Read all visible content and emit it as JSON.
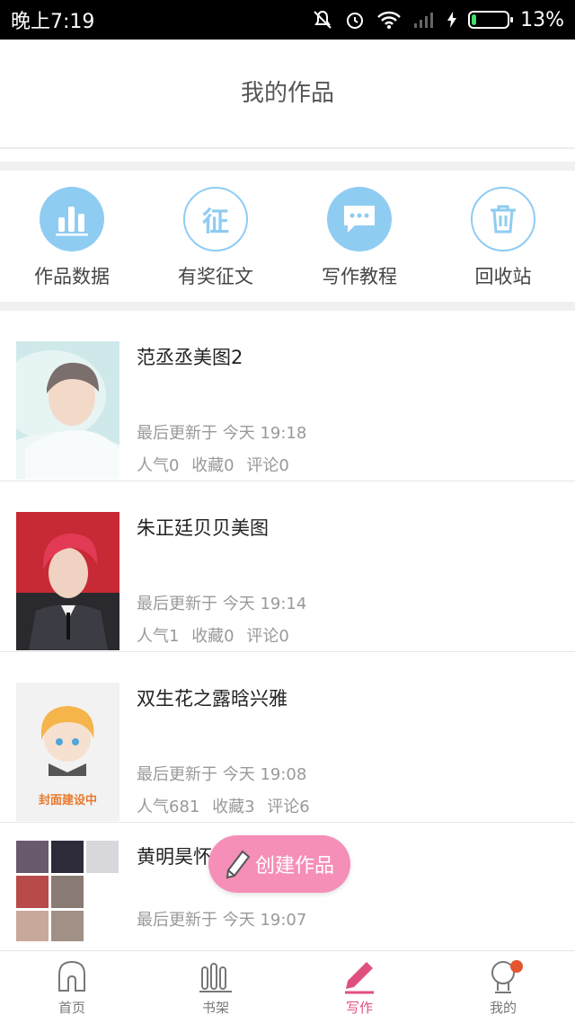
{
  "status_bar": {
    "time": "晚上7:19",
    "battery": "13%",
    "battery_level": 0.13
  },
  "header": {
    "title": "我的作品"
  },
  "quick_actions": [
    {
      "label": "作品数据",
      "icon": "bar-chart-icon"
    },
    {
      "label": "有奖征文",
      "icon": "contest-icon",
      "glyph": "征"
    },
    {
      "label": "写作教程",
      "icon": "chat-bubble-icon"
    },
    {
      "label": "回收站",
      "icon": "trash-icon"
    }
  ],
  "works": [
    {
      "title": "范丞丞美图2",
      "updated": "最后更新于 今天 19:18",
      "popularity": "人气0",
      "favorites": "收藏0",
      "comments": "评论0"
    },
    {
      "title": "朱正廷贝贝美图",
      "updated": "最后更新于 今天 19:14",
      "popularity": "人气1",
      "favorites": "收藏0",
      "comments": "评论0"
    },
    {
      "title": "双生花之露晗兴雅",
      "updated": "最后更新于 今天 19:08",
      "popularity": "人气681",
      "favorites": "收藏3",
      "comments": "评论6",
      "cover_text": "封面建设中"
    },
    {
      "title": "黄明昊怀",
      "updated": "最后更新于 今天 19:07"
    }
  ],
  "fab": {
    "label": "创建作品"
  },
  "tabbar": [
    {
      "label": "首页",
      "icon": "home-icon"
    },
    {
      "label": "书架",
      "icon": "bookshelf-icon"
    },
    {
      "label": "写作",
      "icon": "pen-icon"
    },
    {
      "label": "我的",
      "icon": "profile-icon"
    }
  ],
  "colors": {
    "accent_blue": "#8fccf2",
    "accent_pink": "#f58fb8",
    "active_tab": "#e0507e",
    "notification_dot": "#e4552f"
  }
}
